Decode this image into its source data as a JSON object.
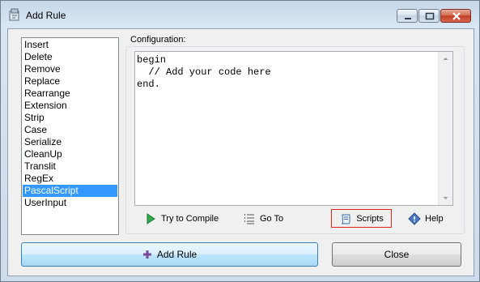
{
  "window": {
    "title": "Add Rule"
  },
  "rules": {
    "items": [
      "Insert",
      "Delete",
      "Remove",
      "Replace",
      "Rearrange",
      "Extension",
      "Strip",
      "Case",
      "Serialize",
      "CleanUp",
      "Translit",
      "RegEx",
      "PascalScript",
      "UserInput"
    ],
    "selected": "PascalScript"
  },
  "config": {
    "label": "Configuration:",
    "code": "begin\n  // Add your code here\nend."
  },
  "toolbar": {
    "compile_label": "Try to Compile",
    "goto_label": "Go To",
    "scripts_label": "Scripts",
    "help_label": "Help"
  },
  "buttons": {
    "add_rule_label": "Add Rule",
    "close_label": "Close"
  },
  "colors": {
    "selection": "#3399ff",
    "scripts_highlight": "#e3231d",
    "compile_icon": "#2fa84f"
  }
}
